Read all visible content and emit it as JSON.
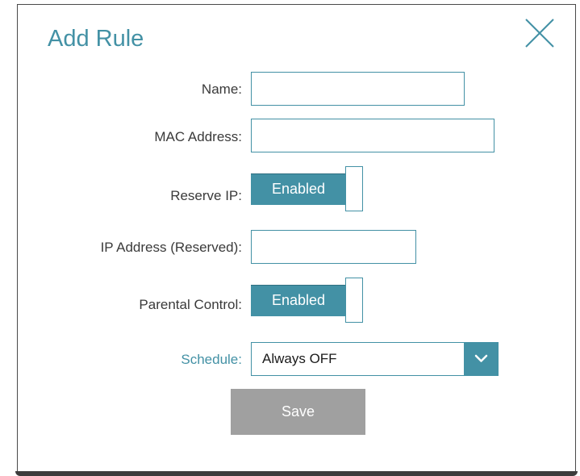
{
  "dialog": {
    "title": "Add Rule"
  },
  "fields": {
    "name": {
      "label": "Name:",
      "value": ""
    },
    "mac_address": {
      "label": "MAC Address:",
      "value": ""
    },
    "reserve_ip": {
      "label": "Reserve IP:",
      "state": "Enabled"
    },
    "ip_address": {
      "label": "IP Address (Reserved):",
      "value": ""
    },
    "parental_control": {
      "label": "Parental Control:",
      "state": "Enabled"
    },
    "schedule": {
      "label": "Schedule:",
      "selected": "Always OFF"
    }
  },
  "actions": {
    "save_label": "Save"
  },
  "icons": {
    "close": "close-icon",
    "dropdown": "chevron-down-icon"
  },
  "colors": {
    "accent": "#4391a5",
    "save_button": "#a0a0a0",
    "text": "#3a3a3a"
  }
}
